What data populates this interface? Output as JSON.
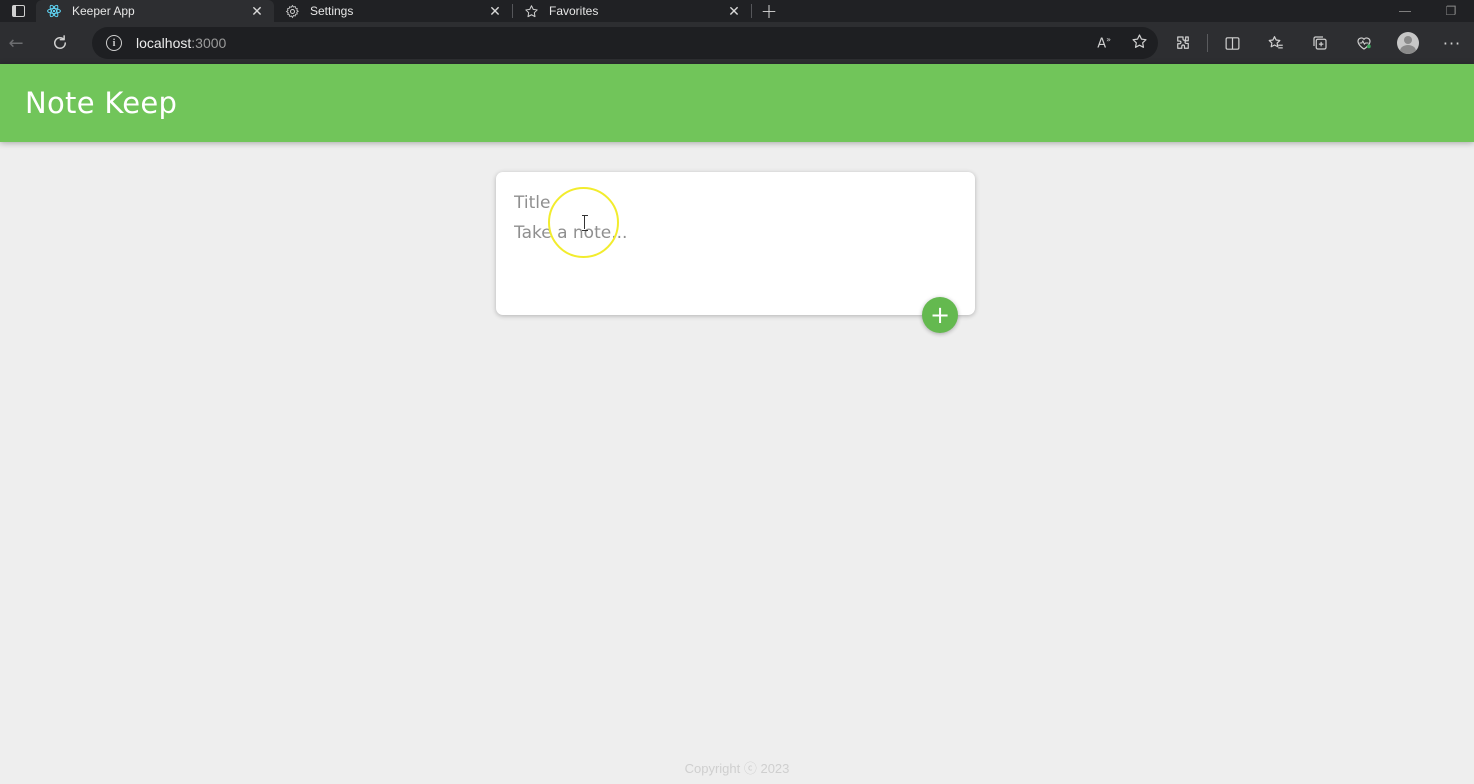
{
  "browser": {
    "tabs": [
      {
        "label": "Keeper App",
        "icon": "react-icon",
        "active": true
      },
      {
        "label": "Settings",
        "icon": "gear-icon",
        "active": false
      },
      {
        "label": "Favorites",
        "icon": "star-icon",
        "active": false
      }
    ],
    "close_glyph": "✕",
    "new_tab_glyph": "+",
    "url_host": "localhost",
    "url_port": ":3000"
  },
  "app": {
    "title": "Note Keep",
    "form": {
      "title_placeholder": "Title",
      "content_placeholder": "Take a note..."
    },
    "add_glyph": "+",
    "footer": "Copyright ⓒ 2023"
  },
  "colors": {
    "header_green": "#71c55a",
    "add_button_green": "#64b94f",
    "page_background": "#eeeeee"
  }
}
